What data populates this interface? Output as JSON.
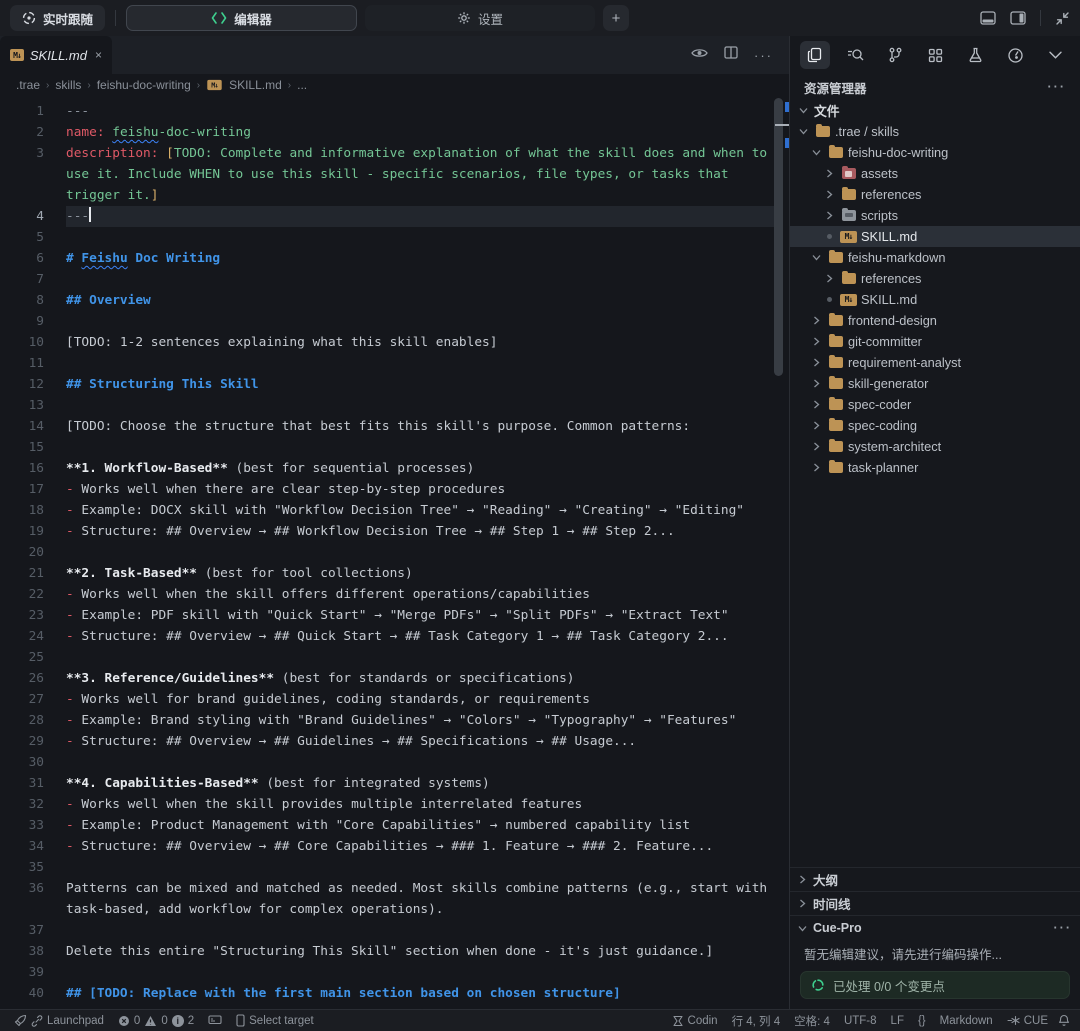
{
  "colors": {
    "accent_green": "#3ecf8e",
    "heading_blue": "#4094e8",
    "key_red": "#de5966",
    "string_green": "#74c695",
    "bracket_yellow": "#d9b06a",
    "folder_tan": "#bd9355",
    "squiggle_blue": "#3b82f6",
    "selection_bg": "#2b3038"
  },
  "title_bar": {
    "live_follow": "实时跟随",
    "editor_tab": "编辑器",
    "settings_tab": "设置",
    "plus": "+"
  },
  "editor": {
    "tab": {
      "file": "SKILL.md",
      "close": "×",
      "md_badge": "M↓"
    },
    "breadcrumb": [
      ".trae",
      "skills",
      "feishu-doc-writing",
      "SKILL.md",
      "..."
    ],
    "lines": [
      {
        "n": "1",
        "seg": [
          [
            "---",
            "s-d"
          ]
        ]
      },
      {
        "n": "2",
        "seg": [
          [
            "name:",
            "s-k"
          ],
          [
            " ",
            "s-g"
          ],
          [
            "feishu",
            "s-g sq"
          ],
          [
            "-doc-writing",
            "s-g"
          ]
        ]
      },
      {
        "n": "3",
        "seg": [
          [
            "description:",
            "s-k"
          ],
          [
            " ",
            ""
          ],
          [
            "[",
            "s-y"
          ],
          [
            "TODO: Complete and informative explanation of what the skill does and when to use it. Include WHEN to use this skill - specific scenarios, file types, or tasks that trigger it.",
            "s-g"
          ],
          [
            "]",
            "s-y"
          ]
        ]
      },
      {
        "n": "4",
        "cur": true,
        "cursor": true,
        "seg": [
          [
            "---",
            "s-d"
          ]
        ]
      },
      {
        "n": "5",
        "seg": []
      },
      {
        "n": "6",
        "seg": [
          [
            "# ",
            "s-h"
          ],
          [
            "Feishu",
            "s-h sq"
          ],
          [
            " Doc Writing",
            "s-h"
          ]
        ]
      },
      {
        "n": "7",
        "seg": []
      },
      {
        "n": "8",
        "seg": [
          [
            "## Overview",
            "s-h"
          ]
        ]
      },
      {
        "n": "9",
        "seg": []
      },
      {
        "n": "10",
        "seg": [
          [
            "[TODO: 1-2 sentences explaining what this skill enables]",
            ""
          ]
        ]
      },
      {
        "n": "11",
        "seg": []
      },
      {
        "n": "12",
        "seg": [
          [
            "## Structuring This Skill",
            "s-h"
          ]
        ]
      },
      {
        "n": "13",
        "seg": []
      },
      {
        "n": "14",
        "seg": [
          [
            "[TODO: Choose the structure that best fits this skill's purpose. Common patterns:",
            ""
          ]
        ]
      },
      {
        "n": "15",
        "seg": []
      },
      {
        "n": "16",
        "seg": [
          [
            "**1. Workflow-Based**",
            "s-b"
          ],
          [
            " (best for sequential processes)",
            ""
          ]
        ]
      },
      {
        "n": "17",
        "seg": [
          [
            "- ",
            "s-k"
          ],
          [
            "Works well when there are clear step-by-step procedures",
            ""
          ]
        ]
      },
      {
        "n": "18",
        "seg": [
          [
            "- ",
            "s-k"
          ],
          [
            "Example: DOCX skill with \"Workflow Decision Tree\" → \"Reading\" → \"Creating\" → \"Editing\"",
            ""
          ]
        ]
      },
      {
        "n": "19",
        "seg": [
          [
            "- ",
            "s-k"
          ],
          [
            "Structure: ## Overview → ## Workflow Decision Tree → ## Step 1 → ## Step 2...",
            ""
          ]
        ]
      },
      {
        "n": "20",
        "seg": []
      },
      {
        "n": "21",
        "seg": [
          [
            "**2. Task-Based**",
            "s-b"
          ],
          [
            " (best for tool collections)",
            ""
          ]
        ]
      },
      {
        "n": "22",
        "seg": [
          [
            "- ",
            "s-k"
          ],
          [
            "Works well when the skill offers different operations/capabilities",
            ""
          ]
        ]
      },
      {
        "n": "23",
        "seg": [
          [
            "- ",
            "s-k"
          ],
          [
            "Example: PDF skill with \"Quick Start\" → \"Merge PDFs\" → \"Split PDFs\" → \"Extract Text\"",
            ""
          ]
        ]
      },
      {
        "n": "24",
        "seg": [
          [
            "- ",
            "s-k"
          ],
          [
            "Structure: ## Overview → ## Quick Start → ## Task Category 1 → ## Task Category 2...",
            ""
          ]
        ]
      },
      {
        "n": "25",
        "seg": []
      },
      {
        "n": "26",
        "seg": [
          [
            "**3. Reference/Guidelines**",
            "s-b"
          ],
          [
            " (best for standards or specifications)",
            ""
          ]
        ]
      },
      {
        "n": "27",
        "seg": [
          [
            "- ",
            "s-k"
          ],
          [
            "Works well for brand guidelines, coding standards, or requirements",
            ""
          ]
        ]
      },
      {
        "n": "28",
        "seg": [
          [
            "- ",
            "s-k"
          ],
          [
            "Example: Brand styling with \"Brand Guidelines\" → \"Colors\" → \"Typography\" → \"Features\"",
            ""
          ]
        ]
      },
      {
        "n": "29",
        "seg": [
          [
            "- ",
            "s-k"
          ],
          [
            "Structure: ## Overview → ## Guidelines → ## Specifications → ## Usage...",
            ""
          ]
        ]
      },
      {
        "n": "30",
        "seg": []
      },
      {
        "n": "31",
        "seg": [
          [
            "**4. Capabilities-Based**",
            "s-b"
          ],
          [
            " (best for integrated systems)",
            ""
          ]
        ]
      },
      {
        "n": "32",
        "seg": [
          [
            "- ",
            "s-k"
          ],
          [
            "Works well when the skill provides multiple interrelated features",
            ""
          ]
        ]
      },
      {
        "n": "33",
        "seg": [
          [
            "- ",
            "s-k"
          ],
          [
            "Example: Product Management with \"Core Capabilities\" → numbered capability list",
            ""
          ]
        ]
      },
      {
        "n": "34",
        "seg": [
          [
            "- ",
            "s-k"
          ],
          [
            "Structure: ## Overview → ## Core Capabilities → ### 1. Feature → ### 2. Feature...",
            ""
          ]
        ]
      },
      {
        "n": "35",
        "seg": []
      },
      {
        "n": "36",
        "seg": [
          [
            "Patterns can be mixed and matched as needed. Most skills combine patterns (e.g., start with task-based, add workflow for complex operations).",
            ""
          ]
        ]
      },
      {
        "n": "37",
        "seg": []
      },
      {
        "n": "38",
        "seg": [
          [
            "Delete this entire \"Structuring This Skill\" section when done - it's just guidance.]",
            ""
          ]
        ]
      },
      {
        "n": "39",
        "seg": []
      },
      {
        "n": "40",
        "seg": [
          [
            "## [TODO: Replace with the first main section based on chosen structure]",
            "s-h"
          ]
        ]
      }
    ]
  },
  "sidebar": {
    "header": "资源管理器",
    "more": "···",
    "tree": [
      {
        "i": 0,
        "c": "v",
        "icon": "none",
        "label": "文件",
        "bold": true
      },
      {
        "i": 0,
        "c": "v",
        "icon": "folder",
        "label": ".trae / skills"
      },
      {
        "i": 1,
        "c": "v",
        "icon": "folder",
        "label": "feishu-doc-writing"
      },
      {
        "i": 2,
        "c": ">",
        "icon": "assets",
        "label": "assets"
      },
      {
        "i": 2,
        "c": ">",
        "icon": "folder",
        "label": "references"
      },
      {
        "i": 2,
        "c": ">",
        "icon": "scripts",
        "label": "scripts"
      },
      {
        "i": 2,
        "c": "dot",
        "icon": "md",
        "label": "SKILL.md",
        "sel": true
      },
      {
        "i": 1,
        "c": "v",
        "icon": "folder",
        "label": "feishu-markdown"
      },
      {
        "i": 2,
        "c": ">",
        "icon": "folder",
        "label": "references"
      },
      {
        "i": 2,
        "c": "dot",
        "icon": "md",
        "label": "SKILL.md"
      },
      {
        "i": 1,
        "c": ">",
        "icon": "folder",
        "label": "frontend-design"
      },
      {
        "i": 1,
        "c": ">",
        "icon": "folder",
        "label": "git-committer"
      },
      {
        "i": 1,
        "c": ">",
        "icon": "folder",
        "label": "requirement-analyst"
      },
      {
        "i": 1,
        "c": ">",
        "icon": "folder",
        "label": "skill-generator"
      },
      {
        "i": 1,
        "c": ">",
        "icon": "folder",
        "label": "spec-coder"
      },
      {
        "i": 1,
        "c": ">",
        "icon": "folder",
        "label": "spec-coding"
      },
      {
        "i": 1,
        "c": ">",
        "icon": "folder",
        "label": "system-architect"
      },
      {
        "i": 1,
        "c": ">",
        "icon": "folder",
        "label": "task-planner"
      }
    ],
    "outline": "大纲",
    "timeline": "时间线",
    "cue_pro": {
      "title": "Cue-Pro",
      "more": "···",
      "message": "暂无编辑建议，请先进行编码操作...",
      "banner": "已处理 0/0 个变更点"
    }
  },
  "status_bar": {
    "launchpad": "Launchpad",
    "errors": "0",
    "warnings": "0",
    "infos": "2",
    "select_target": "Select target",
    "codin": "Codin",
    "cursor_pos": "行 4, 列 4",
    "spaces": "空格: 4",
    "encoding": "UTF-8",
    "eol": "LF",
    "braces": "{}",
    "language": "Markdown",
    "cue": "CUE"
  }
}
